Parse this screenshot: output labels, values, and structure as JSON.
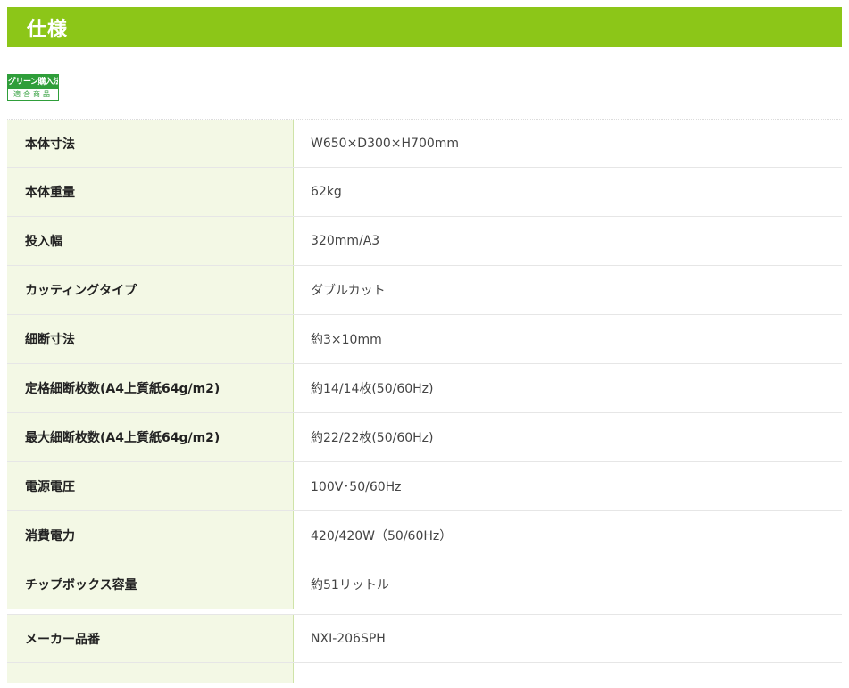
{
  "section": {
    "title": "仕様"
  },
  "badge": {
    "top": "グリーン購入法",
    "bottom": "適合商品"
  },
  "specs": [
    {
      "label": "本体寸法",
      "value": "W650×D300×H700mm"
    },
    {
      "label": "本体重量",
      "value": "62kg"
    },
    {
      "label": "投入幅",
      "value": "320mm/A3"
    },
    {
      "label": "カッティングタイプ",
      "value": "ダブルカット"
    },
    {
      "label": "細断寸法",
      "value": "約3×10mm"
    },
    {
      "label": "定格細断枚数(A4上質紙64g/m2)",
      "value": "約14/14枚(50/60Hz)"
    },
    {
      "label": "最大細断枚数(A4上質紙64g/m2)",
      "value": "約22/22枚(50/60Hz)"
    },
    {
      "label": "電源電圧",
      "value": "100V･50/60Hz"
    },
    {
      "label": "消費電力",
      "value": "420/420W（50/60Hz）"
    },
    {
      "label": "チップボックス容量",
      "value": "約51リットル"
    },
    {
      "label": "メーカー品番",
      "value": "NXI-206SPH"
    }
  ],
  "colors": {
    "accent": "#8cc618",
    "label_bg": "#f3f8e5",
    "badge_green": "#2f9e3a"
  }
}
